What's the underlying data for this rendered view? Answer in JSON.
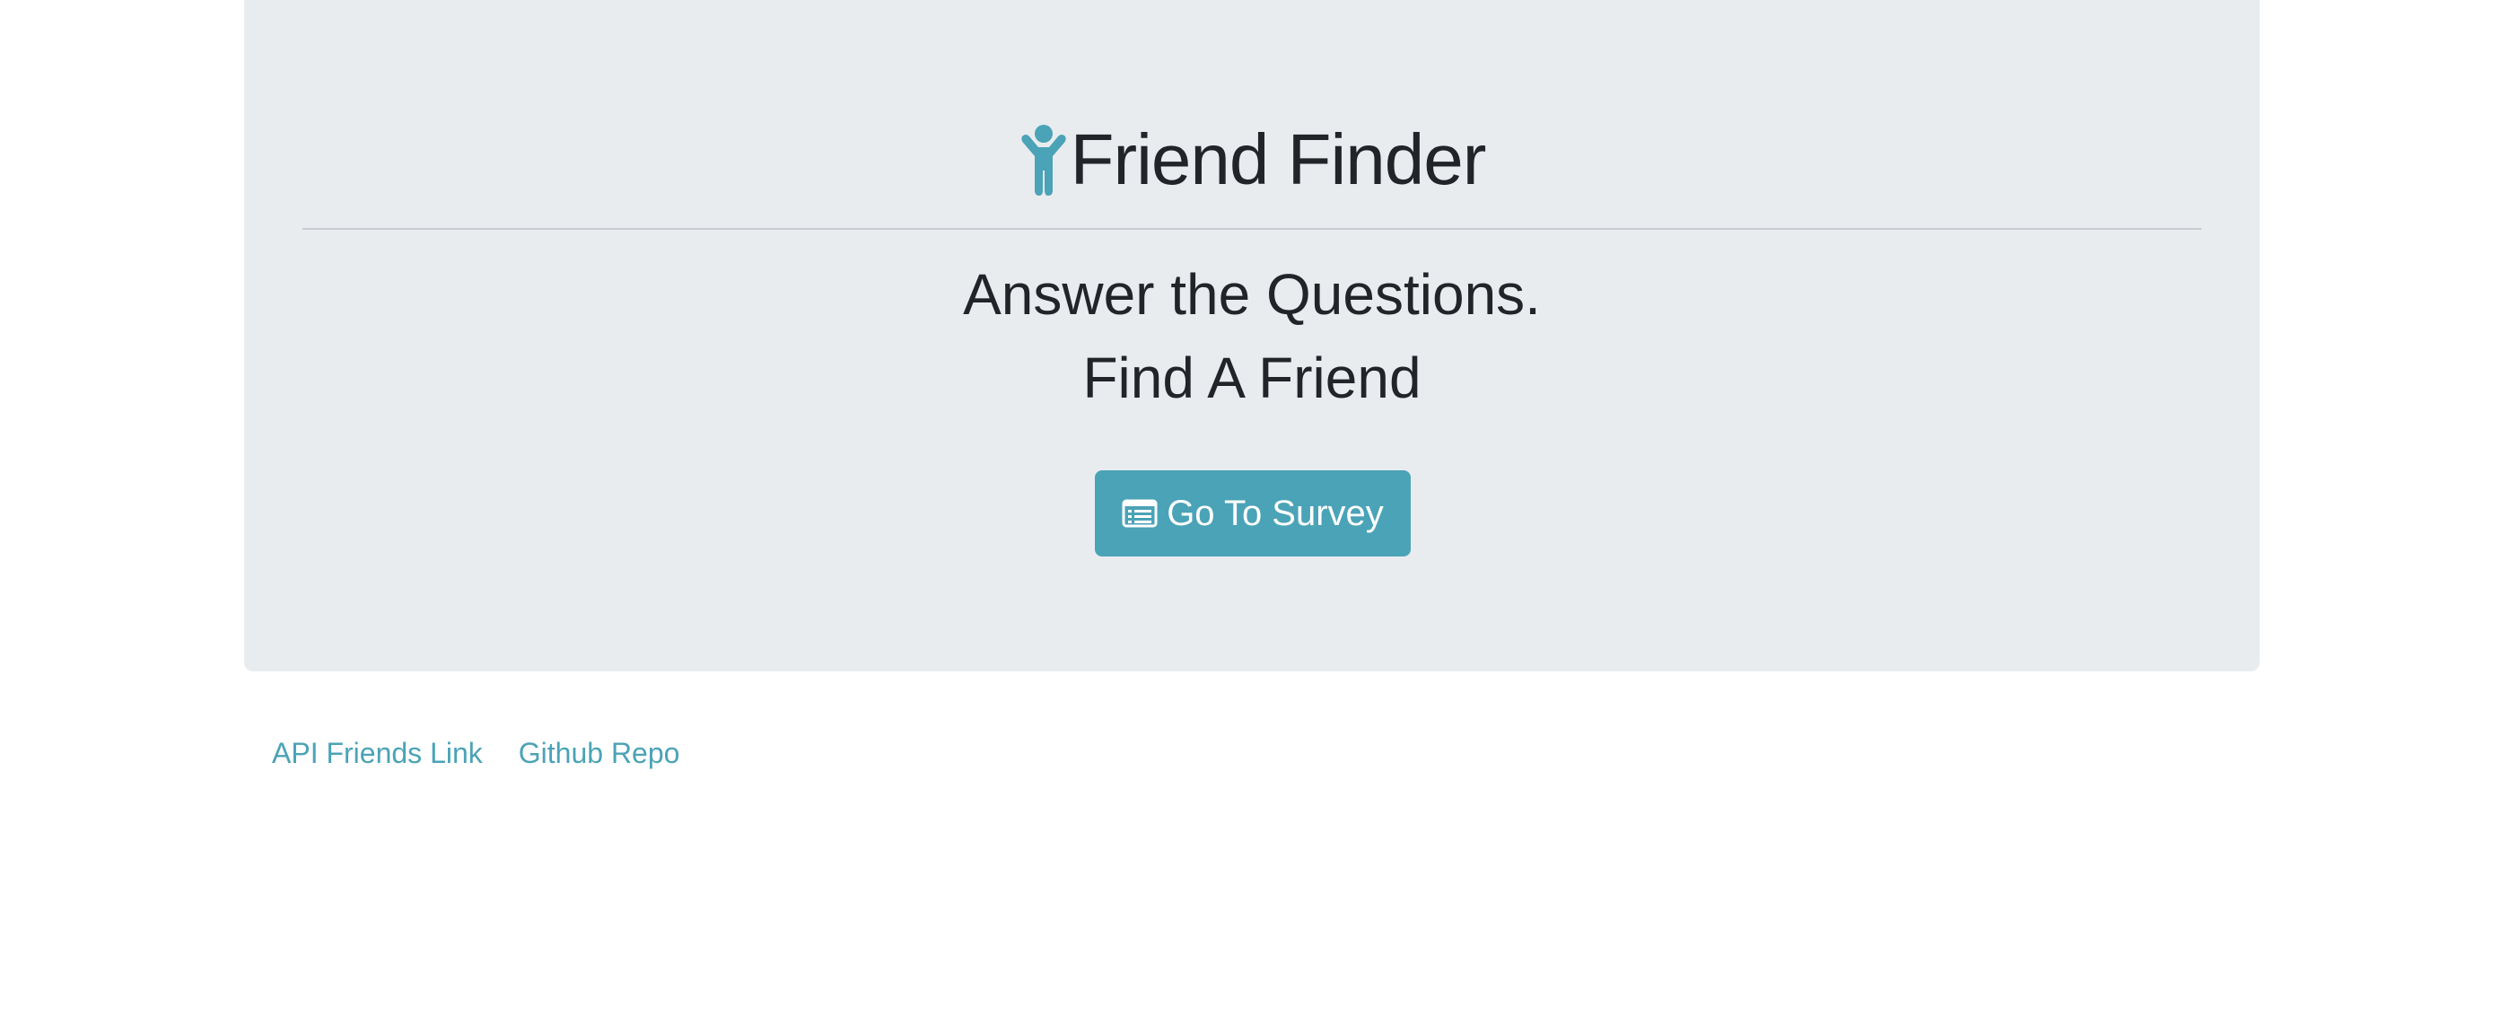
{
  "header": {
    "icon": "child-icon",
    "title": "Friend Finder"
  },
  "tagline": {
    "line1": "Answer the Questions.",
    "line2": "Find A Friend"
  },
  "survey_button": {
    "icon": "list-alt-icon",
    "label": "Go To Survey"
  },
  "footer": {
    "links": [
      {
        "label": "API Friends Link"
      },
      {
        "label": "Github Repo"
      }
    ]
  },
  "colors": {
    "accent": "#4ba3b7",
    "jumbotron_bg": "#e9ecef",
    "text": "#212529"
  }
}
